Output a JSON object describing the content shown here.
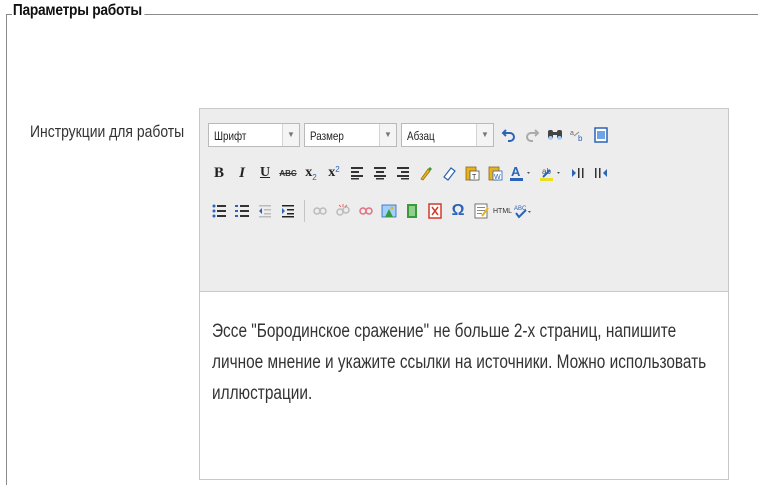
{
  "section": {
    "legend": "Параметры работы"
  },
  "field": {
    "label": "Инструкции для работы"
  },
  "toolbar": {
    "font_select": "Шрифт",
    "size_select": "Размер",
    "format_select": "Абзац",
    "bold": "B",
    "italic": "I",
    "underline": "U",
    "strike": "ABC",
    "subscript": "x",
    "superscript": "x",
    "omega": "Ω",
    "html": "HTML",
    "dropdown_arrow": "▼"
  },
  "colors": {
    "toolbar_bg": "#ededed",
    "icon_blue": "#2a63b8",
    "icon_red": "#d23b2b",
    "icon_green": "#3a9a3a",
    "icon_yellow": "#e8b21e"
  },
  "editor": {
    "content": "Эссе \"Бородинское сражение\" не больше 2-х страниц, напишите личное мнение и укажите ссылки на источники. Можно использовать иллюстрации."
  }
}
